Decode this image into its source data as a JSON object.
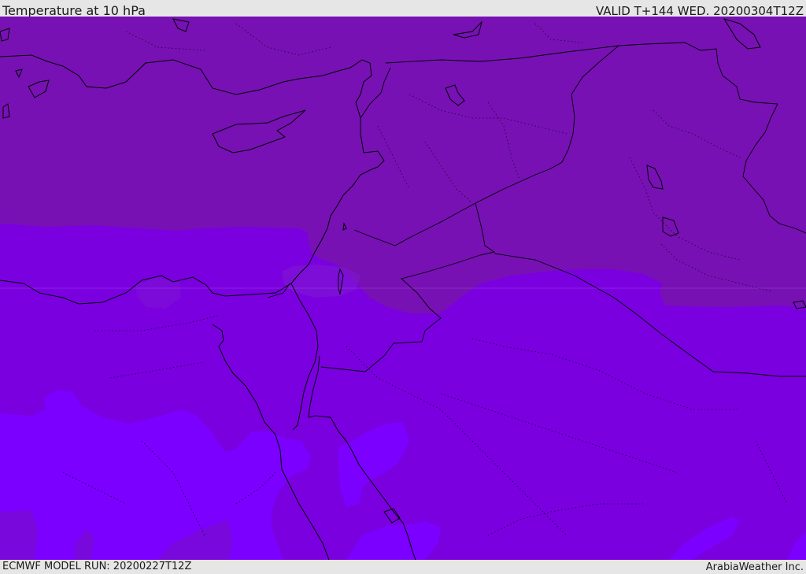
{
  "header": {
    "title": "Temperature at 10 hPa",
    "valid_time": "VALID T+144 WED. 20200304T12Z"
  },
  "footer": {
    "model_run": "ECMWF MODEL RUN: 20200227T12Z",
    "credit": "ArabiaWeather Inc."
  },
  "map": {
    "field": "Temperature",
    "level": "10 hPa",
    "region": "Eastern Mediterranean, Levant, Egypt, Arabian Peninsula",
    "colors": {
      "zone_warm": "#7711b4",
      "zone_mid": "#7a00e0",
      "zone_cold": "#7b00ff",
      "pocket": "#7f1ad0",
      "borders": "#000000"
    }
  }
}
